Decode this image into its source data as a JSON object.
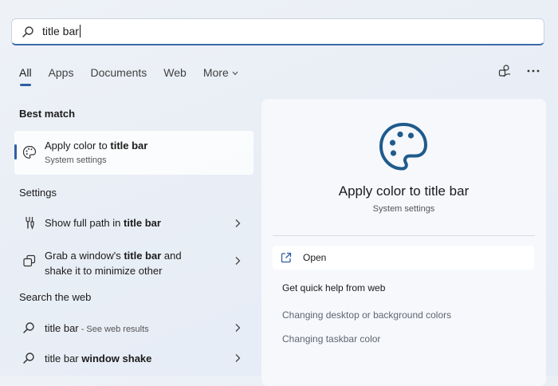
{
  "search": {
    "value": "title bar"
  },
  "tabs": [
    {
      "label": "All"
    },
    {
      "label": "Apps"
    },
    {
      "label": "Documents"
    },
    {
      "label": "Web"
    },
    {
      "label": "More"
    }
  ],
  "toolbar": {
    "icons": [
      "people-feedback-icon",
      "more-options-icon"
    ]
  },
  "best_match": {
    "heading": "Best match",
    "title_prefix": "Apply color to ",
    "title_bold": "title bar",
    "subtitle": "System settings"
  },
  "settings": {
    "heading": "Settings",
    "items": [
      {
        "prefix": "Show full path in ",
        "bold": "title bar",
        "suffix": ""
      },
      {
        "prefix": "Grab a window's ",
        "bold": "title bar",
        "suffix": " and",
        "line2": "shake it to minimize other"
      }
    ]
  },
  "web": {
    "heading": "Search the web",
    "items": [
      {
        "prefix": "title bar",
        "bold": "",
        "note": " - See web results"
      },
      {
        "prefix": "title bar ",
        "bold": "window shake",
        "note": ""
      }
    ]
  },
  "panel": {
    "title": "Apply color to title bar",
    "subtitle": "System settings",
    "open_label": "Open",
    "quick_help": "Get quick help from web",
    "links": [
      "Changing desktop or background colors",
      "Changing taskbar color"
    ]
  },
  "colors": {
    "accent": "#2f5fa0",
    "icon_blue": "#1f5b8c"
  }
}
